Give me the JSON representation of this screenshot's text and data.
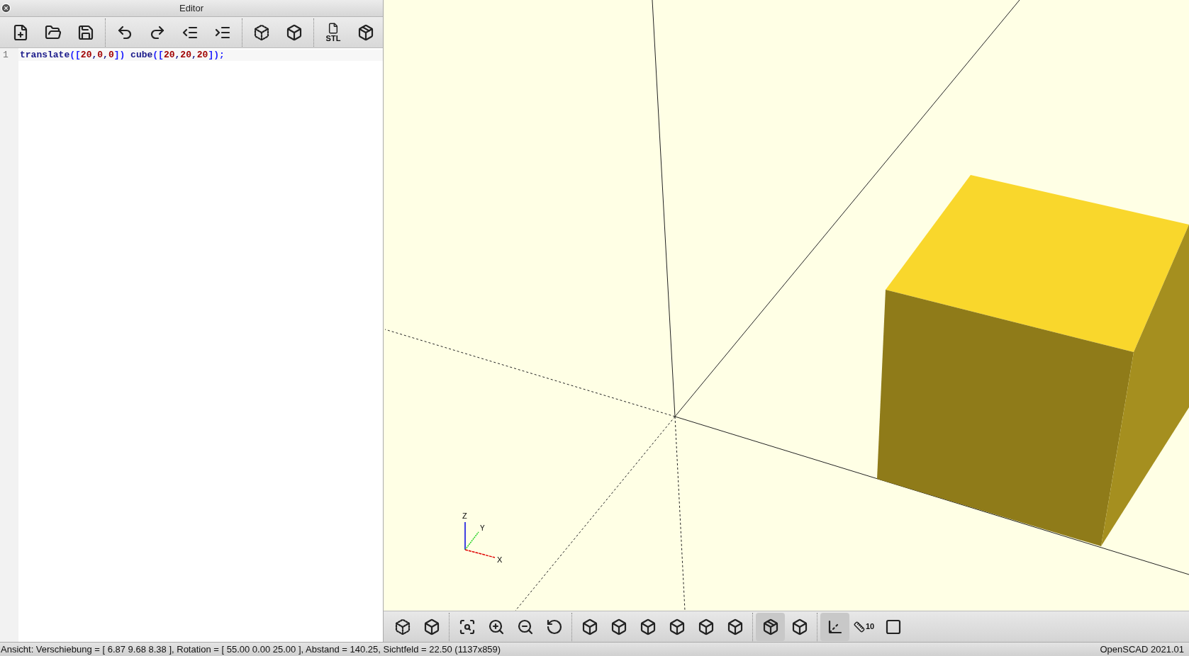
{
  "editor": {
    "title": "Editor",
    "toolbar": [
      {
        "kind": "new"
      },
      {
        "kind": "open"
      },
      {
        "kind": "save"
      },
      {
        "kind": "undo"
      },
      {
        "kind": "redo"
      },
      {
        "kind": "unindent"
      },
      {
        "kind": "indent"
      },
      {
        "kind": "preview"
      },
      {
        "kind": "render"
      },
      {
        "kind": "export",
        "label": "STL"
      },
      {
        "kind": "print"
      }
    ],
    "lines": [
      {
        "number": "1",
        "tokens": [
          {
            "text": "translate",
            "kind": "ident"
          },
          {
            "text": "([",
            "kind": "bracket"
          },
          {
            "text": "20",
            "kind": "number"
          },
          {
            "text": ",",
            "kind": "ident"
          },
          {
            "text": "0",
            "kind": "number"
          },
          {
            "text": ",",
            "kind": "ident"
          },
          {
            "text": "0",
            "kind": "number"
          },
          {
            "text": "])",
            "kind": "bracket"
          },
          {
            "text": " cube",
            "kind": "ident"
          },
          {
            "text": "([",
            "kind": "bracket"
          },
          {
            "text": "20",
            "kind": "number"
          },
          {
            "text": ",",
            "kind": "ident"
          },
          {
            "text": "20",
            "kind": "number"
          },
          {
            "text": ",",
            "kind": "ident"
          },
          {
            "text": "20",
            "kind": "number"
          },
          {
            "text": "]);",
            "kind": "bracket"
          }
        ]
      }
    ]
  },
  "viewport": {
    "axis_labels": {
      "x": "X",
      "y": "Y",
      "z": "Z"
    }
  },
  "view_toolbar": [
    {
      "kind": "preview",
      "selected": false
    },
    {
      "kind": "render",
      "selected": false
    },
    {
      "kind": "view-all",
      "selected": false
    },
    {
      "kind": "zoom-in",
      "selected": false
    },
    {
      "kind": "zoom-out",
      "selected": false
    },
    {
      "kind": "reset",
      "selected": false
    },
    {
      "kind": "view-right",
      "selected": false
    },
    {
      "kind": "view-top",
      "selected": false
    },
    {
      "kind": "view-bottom",
      "selected": false
    },
    {
      "kind": "view-left",
      "selected": false
    },
    {
      "kind": "view-front",
      "selected": false
    },
    {
      "kind": "view-back",
      "selected": false
    },
    {
      "kind": "perspective",
      "selected": true
    },
    {
      "kind": "orthogonal",
      "selected": false
    },
    {
      "kind": "axes",
      "selected": true
    },
    {
      "kind": "scale",
      "selected": false,
      "label": "10"
    },
    {
      "kind": "edges",
      "selected": false
    }
  ],
  "status_bar": {
    "view_info": "Ansicht: Verschiebung = [ 6.87 9.68 8.38 ], Rotation = [ 55.00 0.00 25.00 ], Abstand = 140.25, Sichtfeld = 22.50 (1137x859)",
    "version": "OpenSCAD 2021.01"
  }
}
